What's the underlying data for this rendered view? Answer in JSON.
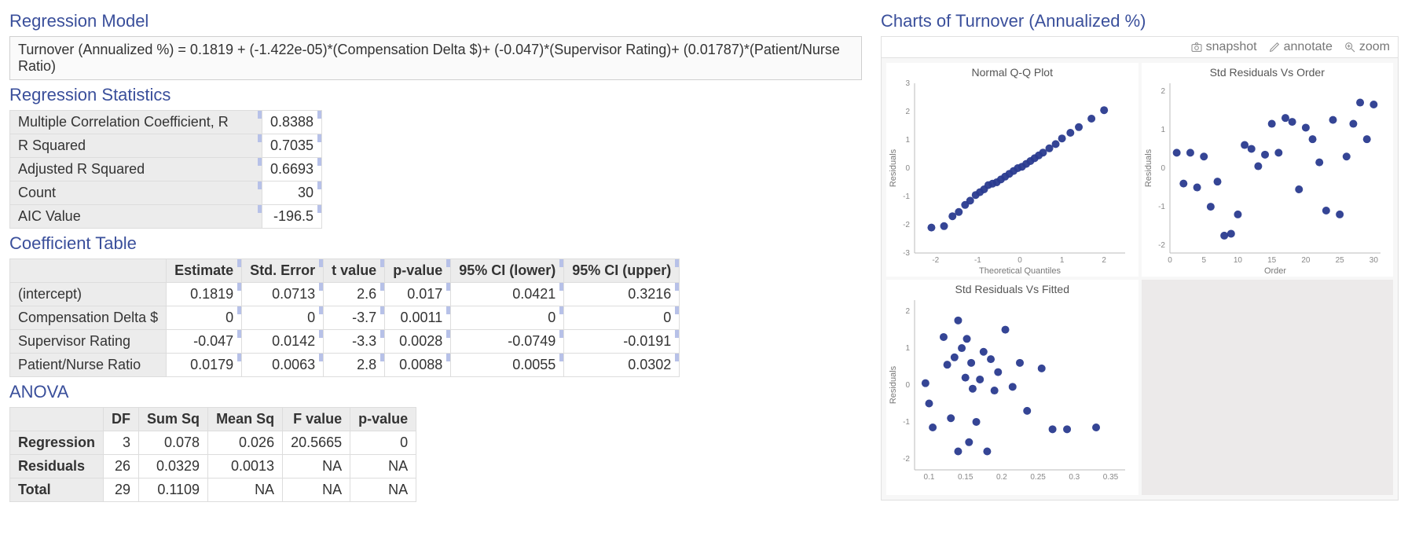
{
  "headings": {
    "regression_model": "Regression Model",
    "regression_statistics": "Regression Statistics",
    "coefficient_table": "Coefficient Table",
    "anova": "ANOVA",
    "charts_title": "Charts of Turnover (Annualized %)"
  },
  "formula": "Turnover (Annualized %) = 0.1819 + (-1.422e-05)*(Compensation Delta $)+ (-0.047)*(Supervisor Rating)+ (0.01787)*(Patient/Nurse Ratio)",
  "stats": [
    {
      "label": "Multiple Correlation Coefficient, R",
      "value": "0.8388"
    },
    {
      "label": "R Squared",
      "value": "0.7035"
    },
    {
      "label": "Adjusted R Squared",
      "value": "0.6693"
    },
    {
      "label": "Count",
      "value": "30"
    },
    {
      "label": "AIC Value",
      "value": "-196.5"
    }
  ],
  "coef": {
    "headers": [
      "",
      "Estimate",
      "Std. Error",
      "t value",
      "p-value",
      "95% CI (lower)",
      "95% CI (upper)"
    ],
    "rows": [
      {
        "label": "(intercept)",
        "cells": [
          "0.1819",
          "0.0713",
          "2.6",
          "0.017",
          "0.0421",
          "0.3216"
        ]
      },
      {
        "label": "Compensation Delta $",
        "cells": [
          "0",
          "0",
          "-3.7",
          "0.0011",
          "0",
          "0"
        ]
      },
      {
        "label": "Supervisor Rating",
        "cells": [
          "-0.047",
          "0.0142",
          "-3.3",
          "0.0028",
          "-0.0749",
          "-0.0191"
        ]
      },
      {
        "label": "Patient/Nurse Ratio",
        "cells": [
          "0.0179",
          "0.0063",
          "2.8",
          "0.0088",
          "0.0055",
          "0.0302"
        ]
      }
    ]
  },
  "anova_tbl": {
    "headers": [
      "",
      "DF",
      "Sum Sq",
      "Mean Sq",
      "F value",
      "p-value"
    ],
    "rows": [
      {
        "label": "Regression",
        "cells": [
          "3",
          "0.078",
          "0.026",
          "20.5665",
          "0"
        ]
      },
      {
        "label": "Residuals",
        "cells": [
          "26",
          "0.0329",
          "0.0013",
          "NA",
          "NA"
        ]
      },
      {
        "label": "Total",
        "cells": [
          "29",
          "0.1109",
          "NA",
          "NA",
          "NA"
        ]
      }
    ]
  },
  "toolbar": {
    "snapshot": "snapshot",
    "annotate": "annotate",
    "zoom": "zoom"
  },
  "chart_data": [
    {
      "type": "scatter",
      "title": "Normal Q-Q Plot",
      "xlabel": "Theoretical Quantiles",
      "ylabel": "Residuals",
      "xlim": [
        -2.5,
        2.5
      ],
      "ylim": [
        -3,
        3
      ],
      "xticks": [
        -2,
        -1,
        0,
        1,
        2
      ],
      "yticks": [
        -3,
        -2,
        -1,
        0,
        1,
        2,
        3
      ],
      "x": [
        -2.1,
        -1.8,
        -1.6,
        -1.45,
        -1.3,
        -1.18,
        -1.05,
        -0.95,
        -0.85,
        -0.75,
        -0.65,
        -0.55,
        -0.45,
        -0.35,
        -0.25,
        -0.15,
        -0.05,
        0.05,
        0.15,
        0.25,
        0.35,
        0.45,
        0.55,
        0.7,
        0.85,
        1.0,
        1.2,
        1.4,
        1.7,
        2.0
      ],
      "y": [
        -2.1,
        -2.05,
        -1.7,
        -1.55,
        -1.3,
        -1.15,
        -0.95,
        -0.85,
        -0.75,
        -0.6,
        -0.55,
        -0.5,
        -0.4,
        -0.3,
        -0.2,
        -0.1,
        0.0,
        0.05,
        0.15,
        0.25,
        0.35,
        0.45,
        0.55,
        0.7,
        0.85,
        1.05,
        1.25,
        1.45,
        1.75,
        2.05
      ]
    },
    {
      "type": "scatter",
      "title": "Std Residuals Vs Order",
      "xlabel": "Order",
      "ylabel": "Residuals",
      "xlim": [
        0,
        31
      ],
      "ylim": [
        -2.2,
        2.2
      ],
      "xticks": [
        0,
        5,
        10,
        15,
        20,
        25,
        30
      ],
      "yticks": [
        -2,
        -1,
        0,
        1,
        2
      ],
      "x": [
        1,
        2,
        3,
        4,
        5,
        6,
        7,
        8,
        9,
        10,
        11,
        12,
        13,
        14,
        15,
        16,
        17,
        18,
        19,
        20,
        21,
        22,
        23,
        24,
        25,
        26,
        27,
        28,
        29,
        30
      ],
      "y": [
        0.4,
        -0.4,
        0.4,
        -0.5,
        0.3,
        -1.0,
        -0.35,
        -1.75,
        -1.7,
        -1.2,
        0.6,
        0.5,
        0.05,
        0.35,
        1.15,
        0.4,
        1.3,
        1.2,
        -0.55,
        1.05,
        0.75,
        0.15,
        -1.1,
        1.25,
        -1.2,
        0.3,
        1.15,
        1.7,
        0.75,
        1.65
      ]
    },
    {
      "type": "scatter",
      "title": "Std Residuals Vs Fitted",
      "xlabel": "",
      "ylabel": "Residuals",
      "xlim": [
        0.08,
        0.37
      ],
      "ylim": [
        -2.3,
        2.3
      ],
      "xticks": [
        0.1,
        0.15,
        0.2,
        0.25,
        0.3,
        0.35
      ],
      "yticks": [
        -2,
        -1,
        0,
        1,
        2
      ],
      "x": [
        0.095,
        0.1,
        0.105,
        0.12,
        0.125,
        0.13,
        0.135,
        0.14,
        0.14,
        0.145,
        0.15,
        0.152,
        0.155,
        0.158,
        0.16,
        0.165,
        0.17,
        0.175,
        0.18,
        0.185,
        0.19,
        0.195,
        0.205,
        0.215,
        0.225,
        0.235,
        0.255,
        0.27,
        0.29,
        0.33
      ],
      "y": [
        0.05,
        -0.5,
        -1.15,
        1.3,
        0.55,
        -0.9,
        0.75,
        1.75,
        -1.8,
        1.0,
        0.2,
        1.25,
        -1.55,
        0.6,
        -0.1,
        -1.0,
        0.15,
        0.9,
        -1.8,
        0.7,
        -0.15,
        0.35,
        1.5,
        -0.05,
        0.6,
        -0.7,
        0.45,
        -1.2,
        -1.2,
        -1.15
      ]
    }
  ]
}
